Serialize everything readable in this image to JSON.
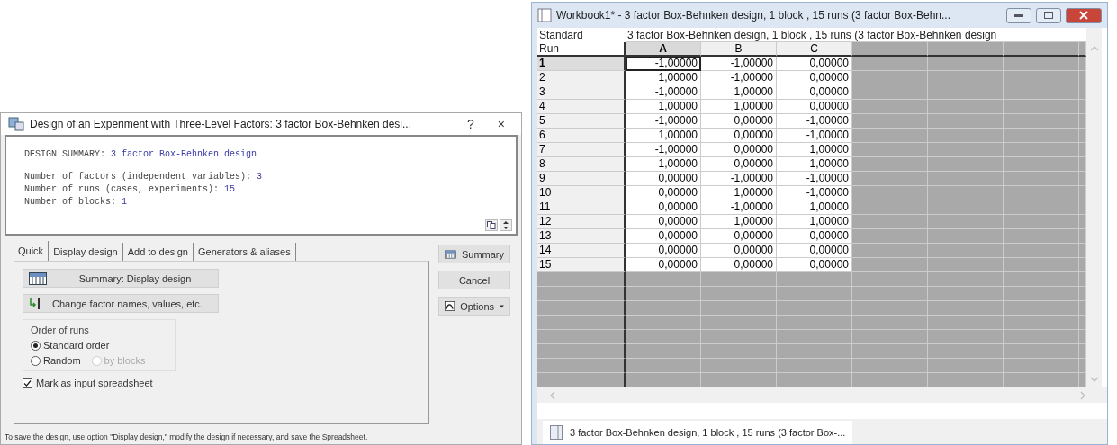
{
  "dialog": {
    "title": "Design of an Experiment with Three-Level Factors: 3 factor Box-Behnken desi...",
    "help": "?",
    "close": "×",
    "summary": [
      {
        "label": "DESIGN SUMMARY:",
        "value": "3 factor Box-Behnken design"
      },
      {
        "label": "Number of factors (independent variables):",
        "value": "3"
      },
      {
        "label": "Number of runs (cases, experiments):",
        "value": "15"
      },
      {
        "label": "Number of blocks:",
        "value": "1"
      }
    ],
    "tabs": [
      {
        "label": "Quick",
        "selected": true
      },
      {
        "label": "Display design",
        "selected": false
      },
      {
        "label": "Add to design",
        "selected": false
      },
      {
        "label": "Generators & aliases",
        "selected": false
      }
    ],
    "actions": [
      {
        "label": "Summary:  Display design",
        "kind": "grid"
      },
      {
        "label": "Change factor names, values, etc.",
        "kind": "edit"
      }
    ],
    "order_group": {
      "title": "Order of runs",
      "options": [
        {
          "label": "Standard order",
          "selected": true,
          "disabled": false
        },
        {
          "label": "Random",
          "selected": false,
          "disabled": false
        },
        {
          "label": "by blocks",
          "selected": false,
          "disabled": true
        }
      ]
    },
    "mark_input": {
      "label": "Mark as input spreadsheet",
      "checked": true
    },
    "buttons": [
      {
        "label": "Summary",
        "kind": "grid"
      },
      {
        "label": "Cancel",
        "kind": "plain"
      },
      {
        "label": "Options",
        "kind": "menu"
      }
    ],
    "status": "To save the design, use option \"Display design,\" modify the design if necessary, and save the Spreadsheet."
  },
  "workbook": {
    "title": "Workbook1* - 3 factor Box-Behnken design, 1 block , 15 runs (3 factor Box-Behn...",
    "sheet_title": "3 factor Box-Behnken design, 1 block , 15 runs (3 factor Box-Behnken design",
    "row_header": [
      "Standard",
      "Run"
    ],
    "columns": [
      {
        "label": "A",
        "selected": true
      },
      {
        "label": "B",
        "selected": false
      },
      {
        "label": "C",
        "selected": false
      }
    ],
    "rows": [
      {
        "run": "1",
        "selected": true,
        "values": [
          "-1,00000",
          "-1,00000",
          "0,00000"
        ]
      },
      {
        "run": "2",
        "selected": false,
        "values": [
          "1,00000",
          "-1,00000",
          "0,00000"
        ]
      },
      {
        "run": "3",
        "selected": false,
        "values": [
          "-1,00000",
          "1,00000",
          "0,00000"
        ]
      },
      {
        "run": "4",
        "selected": false,
        "values": [
          "1,00000",
          "1,00000",
          "0,00000"
        ]
      },
      {
        "run": "5",
        "selected": false,
        "values": [
          "-1,00000",
          "0,00000",
          "-1,00000"
        ]
      },
      {
        "run": "6",
        "selected": false,
        "values": [
          "1,00000",
          "0,00000",
          "-1,00000"
        ]
      },
      {
        "run": "7",
        "selected": false,
        "values": [
          "-1,00000",
          "0,00000",
          "1,00000"
        ]
      },
      {
        "run": "8",
        "selected": false,
        "values": [
          "1,00000",
          "0,00000",
          "1,00000"
        ]
      },
      {
        "run": "9",
        "selected": false,
        "values": [
          "0,00000",
          "-1,00000",
          "-1,00000"
        ]
      },
      {
        "run": "10",
        "selected": false,
        "values": [
          "0,00000",
          "1,00000",
          "-1,00000"
        ]
      },
      {
        "run": "11",
        "selected": false,
        "values": [
          "0,00000",
          "-1,00000",
          "1,00000"
        ]
      },
      {
        "run": "12",
        "selected": false,
        "values": [
          "0,00000",
          "1,00000",
          "1,00000"
        ]
      },
      {
        "run": "13",
        "selected": false,
        "values": [
          "0,00000",
          "0,00000",
          "0,00000"
        ]
      },
      {
        "run": "14",
        "selected": false,
        "values": [
          "0,00000",
          "0,00000",
          "0,00000"
        ]
      },
      {
        "run": "15",
        "selected": false,
        "values": [
          "0,00000",
          "0,00000",
          "0,00000"
        ]
      }
    ],
    "sheet_tab": "3 factor Box-Behnken design, 1 block , 15 runs (3 factor Box-..."
  }
}
